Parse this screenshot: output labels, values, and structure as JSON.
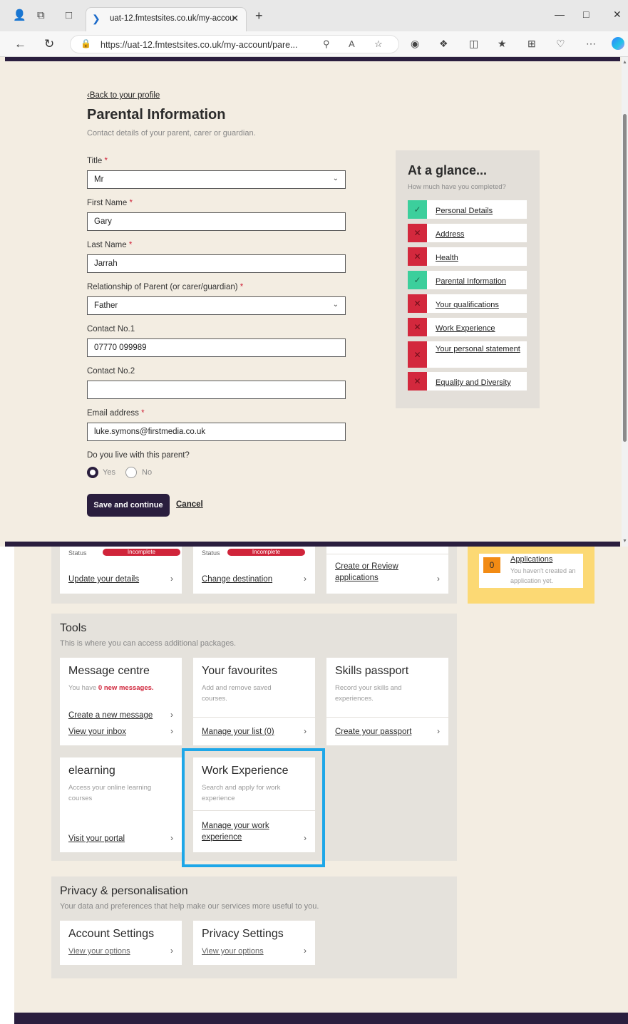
{
  "browser": {
    "tab_title": "uat-12.fmtestsites.co.uk/my-accou",
    "url": "https://uat-12.fmtestsites.co.uk/my-account/pare..."
  },
  "form": {
    "back_link": "Back to your profile",
    "title": "Parental Information",
    "subtitle": "Contact details of your parent, carer or guardian.",
    "fields": {
      "title": {
        "label": "Title",
        "value": "Mr"
      },
      "first_name": {
        "label": "First Name",
        "value": "Gary"
      },
      "last_name": {
        "label": "Last Name",
        "value": "Jarrah"
      },
      "relationship": {
        "label": "Relationship of Parent (or carer/guardian)",
        "value": "Father"
      },
      "contact1": {
        "label": "Contact No.1",
        "value": "07770 099989"
      },
      "contact2": {
        "label": "Contact No.2",
        "value": ""
      },
      "email": {
        "label": "Email address",
        "value": "luke.symons@firstmedia.co.uk"
      }
    },
    "live_with": {
      "label": "Do you live with this parent?",
      "yes": "Yes",
      "no": "No",
      "selected": "Yes"
    },
    "save_label": "Save and continue",
    "cancel_label": "Cancel",
    "required_mark": "*"
  },
  "glance": {
    "title": "At a glance...",
    "subtitle": "How much have you completed?",
    "items": [
      {
        "label": "Personal Details",
        "complete": true
      },
      {
        "label": "Address",
        "complete": false
      },
      {
        "label": "Health",
        "complete": false
      },
      {
        "label": "Parental Information",
        "complete": true
      },
      {
        "label": "Your qualifications",
        "complete": false
      },
      {
        "label": "Work Experience",
        "complete": false
      },
      {
        "label": "Your personal statement",
        "complete": false
      },
      {
        "label": "Equality and Diversity",
        "complete": false
      }
    ]
  },
  "dashboard": {
    "top_cards": [
      {
        "status_label": "Status",
        "status": "Incomplete",
        "link": "Update your details"
      },
      {
        "status_label": "Status",
        "status": "Incomplete",
        "link": "Change destination"
      },
      {
        "link": "Create or Review applications"
      }
    ],
    "applications": {
      "count": "0",
      "title": "Applications",
      "desc": "You haven't created an application yet."
    },
    "tools": {
      "title": "Tools",
      "desc": "This is where you can access additional packages.",
      "message_centre": {
        "title": "Message centre",
        "desc_prefix": "You have ",
        "desc_bold": "0 new messages.",
        "link1": "Create a new message",
        "link2": "View your inbox"
      },
      "favourites": {
        "title": "Your favourites",
        "desc": "Add and remove saved courses.",
        "link": "Manage your list (0)"
      },
      "skills": {
        "title": "Skills passport",
        "desc": "Record your skills and experiences.",
        "link": "Create your passport"
      },
      "elearning": {
        "title": "elearning",
        "desc": "Access your online learning courses",
        "link": "Visit your portal"
      },
      "work_experience": {
        "title": "Work Experience",
        "desc": "Search and apply for work experience",
        "link": "Manage your work experience"
      }
    },
    "privacy": {
      "title": "Privacy & personalisation",
      "desc": "Your data and preferences that help make our services more useful to you.",
      "account": {
        "title": "Account Settings",
        "link": "View your options"
      },
      "privacy_settings": {
        "title": "Privacy Settings",
        "link": "View your options"
      }
    }
  },
  "colors": {
    "brand_dark": "#2a1e3e",
    "complete_green": "#3ccf9c",
    "incomplete_red": "#d3283d",
    "highlight_blue": "#1ea7e8",
    "applications_yellow": "#fcd974"
  }
}
